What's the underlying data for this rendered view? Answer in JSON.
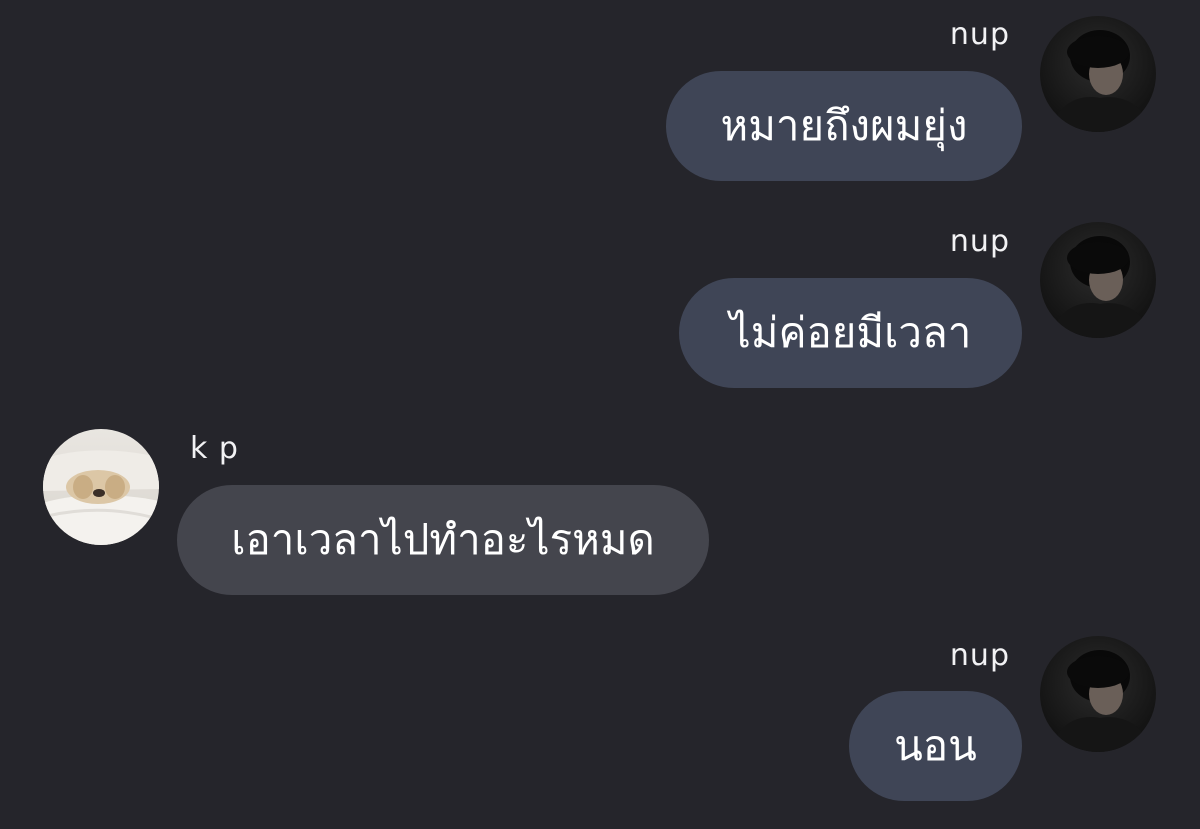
{
  "messages": [
    {
      "sender": "nup",
      "text": "หมายถึงผมยุ่ง",
      "direction": "outgoing",
      "avatar_icon": "person-avatar-icon"
    },
    {
      "sender": "nup",
      "text": "ไม่ค่อยมีเวลา",
      "direction": "outgoing",
      "avatar_icon": "person-avatar-icon"
    },
    {
      "sender": "k p",
      "text": "เอาเวลาไปทำอะไรหมด",
      "direction": "incoming",
      "avatar_icon": "puppy-avatar-icon"
    },
    {
      "sender": "nup",
      "text": "นอน",
      "direction": "outgoing",
      "avatar_icon": "person-avatar-icon"
    }
  ],
  "colors": {
    "background": "#25252b",
    "outgoing_bubble": "#3f4556",
    "incoming_bubble": "#44454d",
    "text": "#ffffff"
  }
}
